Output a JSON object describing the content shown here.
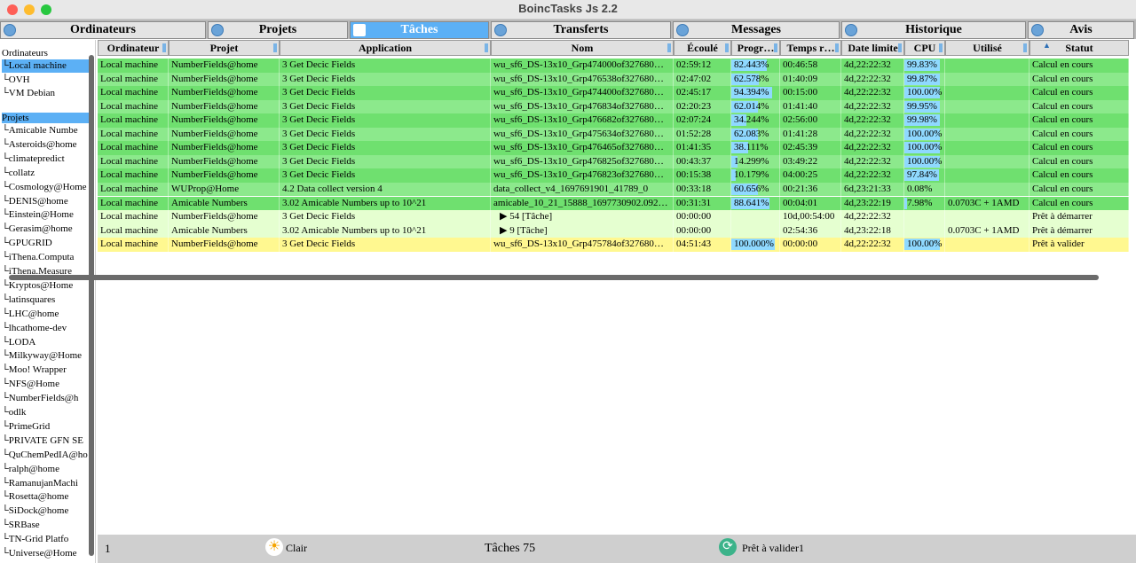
{
  "window": {
    "title": "BoincTasks Js 2.2"
  },
  "tabs": [
    {
      "label": "Ordinateurs",
      "icon": "computer-icon"
    },
    {
      "label": "Projets",
      "icon": "projects-icon"
    },
    {
      "label": "Tâches",
      "icon": "tasks-icon",
      "active": true
    },
    {
      "label": "Transferts",
      "icon": "transfers-icon"
    },
    {
      "label": "Messages",
      "icon": "messages-icon"
    },
    {
      "label": "Historique",
      "icon": "history-icon"
    },
    {
      "label": "Avis",
      "icon": "notices-icon"
    }
  ],
  "sidebar": {
    "computers_header": "Ordinateurs",
    "computers": [
      "└Local machine",
      "└OVH",
      "└VM Debian"
    ],
    "projects_header": "Projets",
    "projects": [
      "└Amicable Numbe",
      "└Asteroids@home",
      "└climatepredict",
      "└collatz",
      "└Cosmology@Home",
      "└DENIS@home",
      "└Einstein@Home",
      "└Gerasim@home",
      "└GPUGRID",
      "└iThena.Computa",
      "└iThena.Measure",
      "└Kryptos@Home",
      "└latinsquares",
      "└LHC@home",
      "└lhcathome-dev",
      "└LODA",
      "└Milkyway@Home",
      "└Moo! Wrapper",
      "└NFS@Home",
      "└NumberFields@h",
      "└odlk",
      "└PrimeGrid",
      "└PRIVATE GFN SE",
      "└QuChemPedIA@ho",
      "└ralph@home",
      "└RamanujanMachi",
      "└Rosetta@home",
      "└SiDock@home",
      "└SRBase",
      "└TN-Grid Platfo",
      "└Universe@Home"
    ]
  },
  "columns": [
    "Ordinateur",
    "Projet",
    "Application",
    "Nom",
    "Écoulé",
    "Progr…",
    "Temps r…",
    "Date limite",
    "CPU",
    "Utilisé",
    "Statut"
  ],
  "sort_indicator": "▲",
  "rows": [
    {
      "style": "g1",
      "computer": "Local machine",
      "project": "NumberFields@home",
      "app": "3 Get Decic Fields",
      "name": "wu_sf6_DS-13x10_Grp474000of327680…",
      "elapsed": "02:59:12",
      "progress": "82.443%",
      "pct": 82.443,
      "remaining": "00:46:58",
      "deadline": "4d,22:22:32",
      "cpu": "99.83%",
      "cpupct": 99.83,
      "used": "",
      "status": "Calcul en cours"
    },
    {
      "style": "g2",
      "computer": "Local machine",
      "project": "NumberFields@home",
      "app": "3 Get Decic Fields",
      "name": "wu_sf6_DS-13x10_Grp476538of327680…",
      "elapsed": "02:47:02",
      "progress": "62.578%",
      "pct": 62.578,
      "remaining": "01:40:09",
      "deadline": "4d,22:22:32",
      "cpu": "99.87%",
      "cpupct": 99.87,
      "used": "",
      "status": "Calcul en cours"
    },
    {
      "style": "g1",
      "computer": "Local machine",
      "project": "NumberFields@home",
      "app": "3 Get Decic Fields",
      "name": "wu_sf6_DS-13x10_Grp474400of327680…",
      "elapsed": "02:45:17",
      "progress": "94.394%",
      "pct": 94.394,
      "remaining": "00:15:00",
      "deadline": "4d,22:22:32",
      "cpu": "100.00%",
      "cpupct": 100,
      "used": "",
      "status": "Calcul en cours"
    },
    {
      "style": "g2",
      "computer": "Local machine",
      "project": "NumberFields@home",
      "app": "3 Get Decic Fields",
      "name": "wu_sf6_DS-13x10_Grp476834of327680…",
      "elapsed": "02:20:23",
      "progress": "62.014%",
      "pct": 62.014,
      "remaining": "01:41:40",
      "deadline": "4d,22:22:32",
      "cpu": "99.95%",
      "cpupct": 99.95,
      "used": "",
      "status": "Calcul en cours"
    },
    {
      "style": "g1",
      "computer": "Local machine",
      "project": "NumberFields@home",
      "app": "3 Get Decic Fields",
      "name": "wu_sf6_DS-13x10_Grp476682of327680…",
      "elapsed": "02:07:24",
      "progress": "34.244%",
      "pct": 34.244,
      "remaining": "02:56:00",
      "deadline": "4d,22:22:32",
      "cpu": "99.98%",
      "cpupct": 99.98,
      "used": "",
      "status": "Calcul en cours"
    },
    {
      "style": "g2",
      "computer": "Local machine",
      "project": "NumberFields@home",
      "app": "3 Get Decic Fields",
      "name": "wu_sf6_DS-13x10_Grp475634of327680…",
      "elapsed": "01:52:28",
      "progress": "62.083%",
      "pct": 62.083,
      "remaining": "01:41:28",
      "deadline": "4d,22:22:32",
      "cpu": "100.00%",
      "cpupct": 100,
      "used": "",
      "status": "Calcul en cours"
    },
    {
      "style": "g1",
      "computer": "Local machine",
      "project": "NumberFields@home",
      "app": "3 Get Decic Fields",
      "name": "wu_sf6_DS-13x10_Grp476465of327680…",
      "elapsed": "01:41:35",
      "progress": "38.111%",
      "pct": 38.111,
      "remaining": "02:45:39",
      "deadline": "4d,22:22:32",
      "cpu": "100.00%",
      "cpupct": 100,
      "used": "",
      "status": "Calcul en cours"
    },
    {
      "style": "g2",
      "computer": "Local machine",
      "project": "NumberFields@home",
      "app": "3 Get Decic Fields",
      "name": "wu_sf6_DS-13x10_Grp476825of327680…",
      "elapsed": "00:43:37",
      "progress": "14.299%",
      "pct": 14.299,
      "remaining": "03:49:22",
      "deadline": "4d,22:22:32",
      "cpu": "100.00%",
      "cpupct": 100,
      "used": "",
      "status": "Calcul en cours"
    },
    {
      "style": "g1",
      "computer": "Local machine",
      "project": "NumberFields@home",
      "app": "3 Get Decic Fields",
      "name": "wu_sf6_DS-13x10_Grp476823of327680…",
      "elapsed": "00:15:38",
      "progress": "10.179%",
      "pct": 10.179,
      "remaining": "04:00:25",
      "deadline": "4d,22:22:32",
      "cpu": "97.84%",
      "cpupct": 97.84,
      "used": "",
      "status": "Calcul en cours"
    },
    {
      "style": "g2",
      "computer": "Local machine",
      "project": "WUProp@Home",
      "app": "4.2 Data collect version 4",
      "name": "data_collect_v4_1697691901_41789_0",
      "elapsed": "00:33:18",
      "progress": "60.656%",
      "pct": 60.656,
      "remaining": "00:21:36",
      "deadline": "6d,23:21:33",
      "cpu": "0.08%",
      "cpupct": 0.08,
      "used": "",
      "status": "Calcul en cours"
    },
    {
      "style": "g1",
      "computer": "Local machine",
      "project": "Amicable Numbers",
      "app": "3.02 Amicable Numbers up to 10^21",
      "name": "amicable_10_21_15888_1697730902.092…",
      "elapsed": "00:31:31",
      "progress": "88.641%",
      "pct": 88.641,
      "remaining": "00:04:01",
      "deadline": "4d,23:22:19",
      "cpu": "7.98%",
      "cpupct": 7.98,
      "used": "0.0703C + 1AMD",
      "status": "Calcul en cours"
    },
    {
      "style": "wait",
      "computer": "Local machine",
      "project": "NumberFields@home",
      "app": "3 Get Decic Fields",
      "name": "▶ 54 [Tâche]",
      "elapsed": "00:00:00",
      "progress": "",
      "pct": 0,
      "remaining": "10d,00:54:00",
      "deadline": "4d,22:22:32",
      "cpu": "",
      "cpupct": 0,
      "used": "",
      "status": "Prêt à démarrer"
    },
    {
      "style": "wait",
      "computer": "Local machine",
      "project": "Amicable Numbers",
      "app": "3.02 Amicable Numbers up to 10^21",
      "name": "▶ 9 [Tâche]",
      "elapsed": "00:00:00",
      "progress": "",
      "pct": 0,
      "remaining": "02:54:36",
      "deadline": "4d,23:22:18",
      "cpu": "",
      "cpupct": 0,
      "used": "0.0703C + 1AMD",
      "status": "Prêt à démarrer"
    },
    {
      "style": "valid",
      "computer": "Local machine",
      "project": "NumberFields@home",
      "app": "3 Get Decic Fields",
      "name": "wu_sf6_DS-13x10_Grp475784of327680…",
      "elapsed": "04:51:43",
      "progress": "100.000%",
      "pct": 100,
      "remaining": "00:00:00",
      "deadline": "4d,22:22:32",
      "cpu": "100.00%",
      "cpupct": 100,
      "used": "",
      "status": "Prêt à valider"
    }
  ],
  "statusbar": {
    "count": "1",
    "theme_label": "Clair",
    "tasks_label": "Tâches 75",
    "validate_label": "Prêt à valider1"
  }
}
